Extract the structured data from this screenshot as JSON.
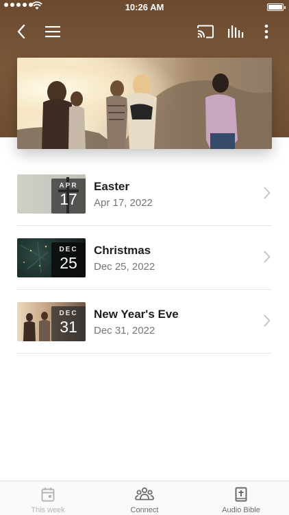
{
  "status_bar": {
    "time": "10:26 AM"
  },
  "nav": {
    "back_icon": "chevron-left-icon",
    "menu_icon": "hamburger-menu-icon",
    "cast_icon": "cast-icon",
    "audio_icon": "audio-bars-icon",
    "more_icon": "more-vertical-icon"
  },
  "hero": {
    "image": "group of friends outdoors at sunset"
  },
  "events": [
    {
      "month": "APR",
      "day": "17",
      "title": "Easter",
      "date": "Apr 17, 2022"
    },
    {
      "month": "DEC",
      "day": "25",
      "title": "Christmas",
      "date": "Dec 25, 2022"
    },
    {
      "month": "DEC",
      "day": "31",
      "title": "New Year's Eve",
      "date": "Dec 31, 2022"
    }
  ],
  "tabs": [
    {
      "label": "This week",
      "icon": "calendar-icon",
      "color": "#b5b5b5"
    },
    {
      "label": "Connect",
      "icon": "people-group-icon",
      "color": "#6b6b6b"
    },
    {
      "label": "Audio Bible",
      "icon": "bible-icon",
      "color": "#6b6b6b"
    }
  ],
  "colors": {
    "header_brown": "#7a5739",
    "chevron": "#c4c4c4",
    "separator": "#e5e5e5"
  }
}
